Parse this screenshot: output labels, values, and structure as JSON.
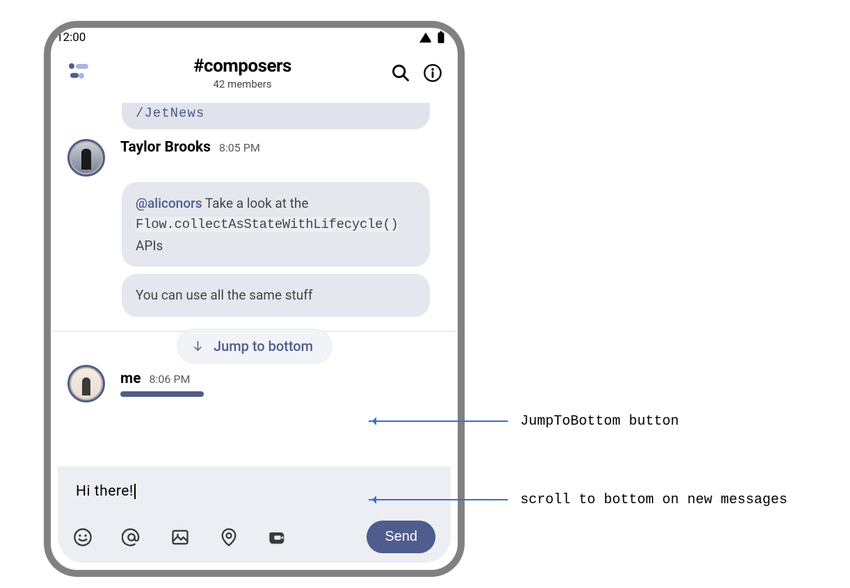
{
  "status": {
    "time": "12:00"
  },
  "header": {
    "channel": "#composers",
    "members": "42 members"
  },
  "messages": {
    "partial_top": "/JetNews",
    "taylor": {
      "author": "Taylor Brooks",
      "time": "8:05 PM",
      "bubble1_mention": "@aliconors",
      "bubble1_text1": " Take a look at the ",
      "bubble1_code": "Flow.collectAsStateWithLifecycle()",
      "bubble1_text2": " APIs",
      "bubble2": "You can use all the same stuff"
    },
    "me": {
      "author": "me",
      "time": "8:06 PM"
    }
  },
  "jump": {
    "label": "Jump to bottom"
  },
  "input": {
    "text": "Hi there!",
    "send": "Send"
  },
  "callouts": {
    "jump": "JumpToBottom button",
    "scroll": "scroll to bottom on new messages"
  }
}
